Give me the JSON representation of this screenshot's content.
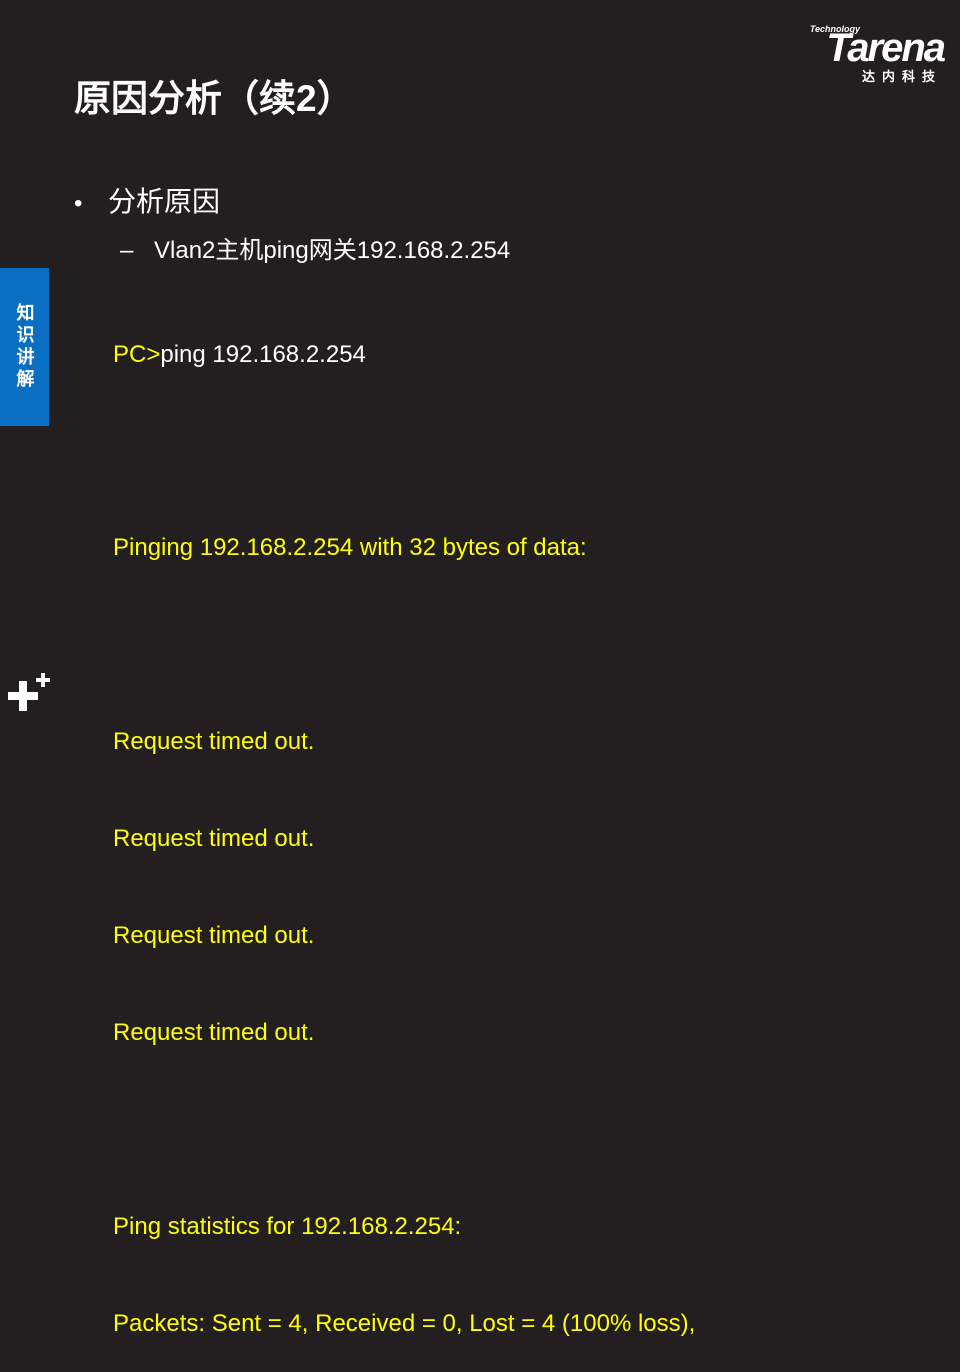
{
  "logo": {
    "brand": "Tarena",
    "tagline": "Technology",
    "chinese": "达内科技"
  },
  "title": "原因分析（续2）",
  "bullet": {
    "text": "分析原因",
    "sub": "Vlan2主机ping网关192.168.2.254"
  },
  "console": {
    "prompt": "PC>",
    "command": "ping 192.168.2.254",
    "lines": [
      "",
      "Pinging 192.168.2.254 with 32 bytes of data:",
      "",
      "Request timed out.",
      "Request timed out.",
      "Request timed out.",
      "Request timed out.",
      "",
      "Ping statistics for 192.168.2.254:",
      "Packets: Sent = 4, Received = 0, Lost = 4 (100% loss),"
    ]
  },
  "side_tab": "知识讲解",
  "colors": {
    "background": "#231f20",
    "console_text": "#ffff00",
    "tab_blue": "#0a6fc2"
  }
}
